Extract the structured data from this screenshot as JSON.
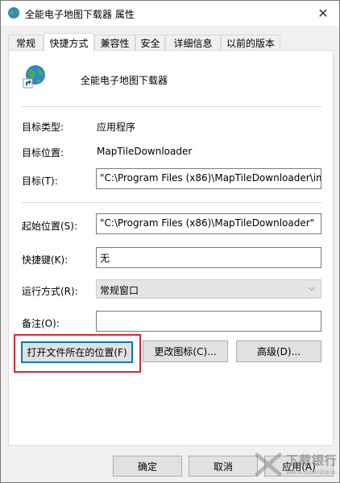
{
  "window": {
    "title": "全能电子地图下载器 属性",
    "close_glyph": "✕"
  },
  "tabs": [
    {
      "label": "常规",
      "active": false
    },
    {
      "label": "快捷方式",
      "active": true
    },
    {
      "label": "兼容性",
      "active": false
    },
    {
      "label": "安全",
      "active": false
    },
    {
      "label": "详细信息",
      "active": false
    },
    {
      "label": "以前的版本",
      "active": false
    }
  ],
  "shortcut": {
    "name": "全能电子地图下载器",
    "target_type_label": "目标类型:",
    "target_type": "应用程序",
    "target_location_label": "目标位置:",
    "target_location": "MapTileDownloader",
    "target_label": "目标(T):",
    "target_value": "\"C:\\Program Files (x86)\\MapTileDownloader\\ima",
    "start_in_label": "起始位置(S):",
    "start_in_value": "\"C:\\Program Files (x86)\\MapTileDownloader\"",
    "hotkey_label": "快捷键(K):",
    "hotkey_value": "无",
    "run_label": "运行方式(R):",
    "run_value": "常规窗口",
    "comment_label": "备注(O):",
    "comment_value": ""
  },
  "buttons": {
    "open_location": "打开文件所在的位置(F)",
    "change_icon": "更改图标(C)...",
    "advanced": "高级(D)...",
    "ok": "确定",
    "cancel": "取消",
    "apply": "应用(A)"
  },
  "watermark": {
    "text": "下载银行",
    "sub": "www.downbank.cn"
  },
  "colors": {
    "highlight": "#e0252b",
    "focus": "#0078d7"
  }
}
